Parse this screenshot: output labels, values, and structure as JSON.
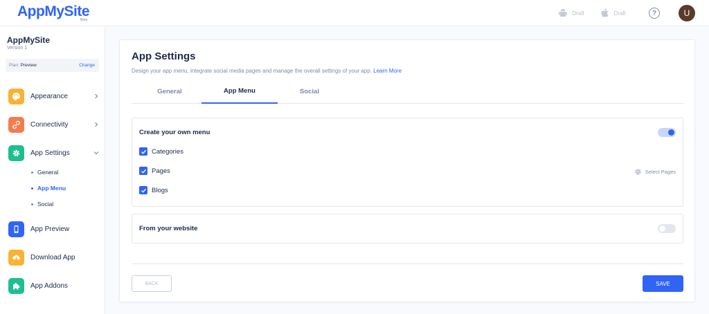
{
  "header": {
    "logo_text": "AppMySite",
    "logo_badge": "Beta",
    "android_status": "Draft",
    "ios_status": "Draft",
    "help_symbol": "?",
    "avatar_initial": "U",
    "android_icon": "android-icon",
    "apple_icon": "apple-icon"
  },
  "sidebar": {
    "app_name": "AppMySite",
    "app_version": "Version 1",
    "plan_label": "Plan:",
    "plan_value": "Preview",
    "plan_change": "Change",
    "items": [
      {
        "label": "Appearance",
        "icon": "palette-icon",
        "color": "#f9b234"
      },
      {
        "label": "Connectivity",
        "icon": "link-icon",
        "color": "#f47c4c"
      },
      {
        "label": "App Settings",
        "icon": "gear-icon",
        "color": "#1dbf8f"
      },
      {
        "label": "App Preview",
        "icon": "phone-icon",
        "color": "#3064f6"
      },
      {
        "label": "Download App",
        "icon": "cloud-download-icon",
        "color": "#f9b234"
      },
      {
        "label": "App Addons",
        "icon": "puzzle-icon",
        "color": "#1dbf8f"
      }
    ],
    "sub_items": [
      {
        "label": "General"
      },
      {
        "label": "App Menu"
      },
      {
        "label": "Social"
      }
    ]
  },
  "main": {
    "title": "App Settings",
    "subtitle": "Design your app menu, integrate social media pages and manage the overall settings of your app.",
    "learn_more": "Learn More",
    "tabs": [
      {
        "label": "General"
      },
      {
        "label": "App Menu"
      },
      {
        "label": "Social"
      }
    ],
    "custom_menu": {
      "title": "Create your own menu",
      "enabled": true,
      "options": [
        {
          "label": "Categories",
          "checked": true
        },
        {
          "label": "Pages",
          "checked": true
        },
        {
          "label": "Blogs",
          "checked": true
        }
      ],
      "select_pages": "Select Pages"
    },
    "website_menu": {
      "title": "From your website",
      "enabled": false
    },
    "back_button": "BACK",
    "save_button": "SAVE"
  },
  "colors": {
    "accent": "#3064f6",
    "text": "#1b2a4a",
    "muted": "#7d8aa6"
  }
}
